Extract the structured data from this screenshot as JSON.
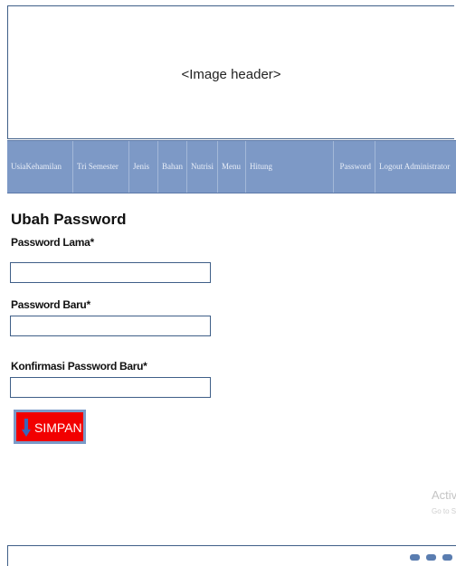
{
  "header": {
    "placeholder": "<Image header>"
  },
  "nav": {
    "items": [
      {
        "label": "UsiaKehamilan"
      },
      {
        "label": "Tri Semester"
      },
      {
        "label": "Jenis"
      },
      {
        "label": "Bahan"
      },
      {
        "label": "Nutrisi"
      },
      {
        "label": "Menu"
      },
      {
        "label": "Hitung"
      },
      {
        "label": "Password"
      },
      {
        "label": "Logout Administrator"
      }
    ]
  },
  "form": {
    "title": "Ubah Password",
    "fields": [
      {
        "label": "Password Lama*",
        "value": ""
      },
      {
        "label": "Password  Baru*",
        "value": ""
      },
      {
        "label": "Konfirmasi Password  Baru*",
        "value": ""
      }
    ],
    "submit_label": "SIMPAN"
  },
  "watermark": {
    "line1": "Activa",
    "line2": "Go to S"
  },
  "colors": {
    "nav_background": "#7d99c6",
    "border": "#3f5f88",
    "submit_background": "#f20000",
    "submit_arrow": "#3a66b8"
  }
}
